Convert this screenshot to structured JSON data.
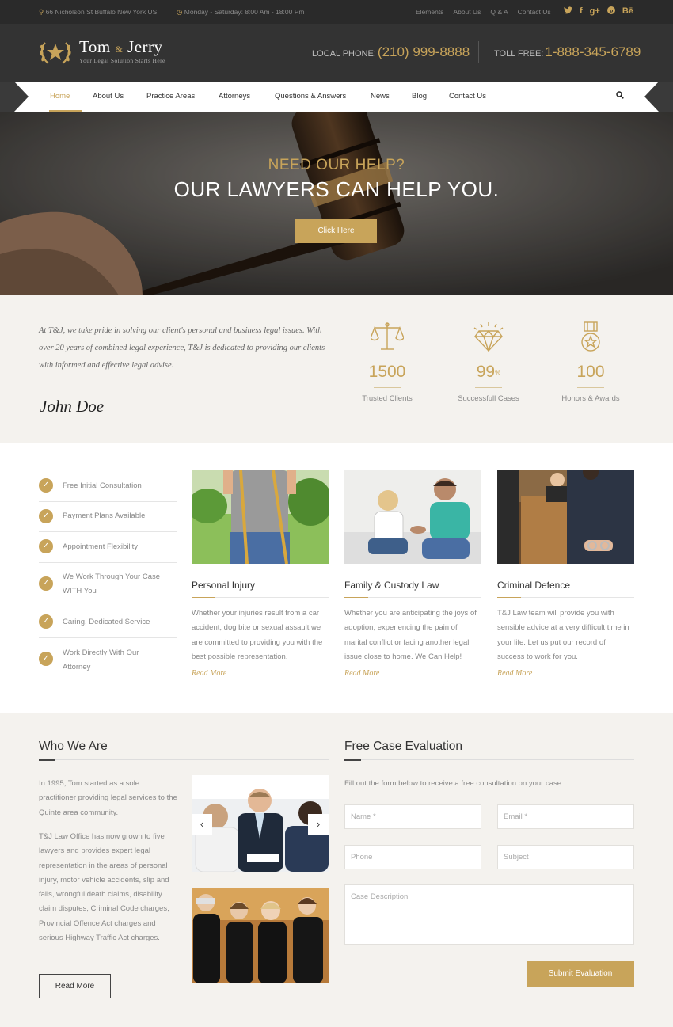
{
  "topbar": {
    "address": "66 Nicholson St Buffalo New York US",
    "hours": "Monday - Saturday: 8:00 Am - 18:00 Pm",
    "links": [
      "Elements",
      "About Us",
      "Q & A",
      "Contact Us"
    ],
    "social": [
      "twitter-icon",
      "facebook-icon",
      "google-plus-icon",
      "pinterest-icon",
      "behance-icon"
    ],
    "behance_label": "Bē"
  },
  "header": {
    "brand_main1": "Tom",
    "brand_amp": "&",
    "brand_main2": "Jerry",
    "tagline": "Your Legal Solution Starts Here",
    "local_label": "LOCAL PHONE:",
    "local_number": "(210) 999-8888",
    "tollfree_label": "TOLL FREE:",
    "tollfree_number": "1-888-345-6789"
  },
  "nav": {
    "items": [
      "Home",
      "About Us",
      "Practice Areas",
      "Attorneys",
      "Questions & Answers",
      "News",
      "Blog",
      "Contact Us"
    ],
    "active": "Home"
  },
  "hero": {
    "kicker": "NEED OUR HELP?",
    "headline": "OUR LAWYERS CAN HELP YOU.",
    "button": "Click Here"
  },
  "intro": {
    "quote": "At T&J, we take pride in solving our client's personal and business legal issues. With over 20 years of combined legal experience, T&J is dedicated to providing our clients with informed and effective legal advise.",
    "signature": "John Doe",
    "stats": [
      {
        "icon": "scales-icon",
        "value": "1500",
        "suffix": "",
        "label": "Trusted Clients"
      },
      {
        "icon": "diamond-icon",
        "value": "99",
        "suffix": "%",
        "label": "Successfull Cases"
      },
      {
        "icon": "medal-icon",
        "value": "100",
        "suffix": "",
        "label": "Honors & Awards"
      }
    ]
  },
  "features": [
    "Free Initial Consultation",
    "Payment Plans Available",
    "Appointment Flexibility",
    "We Work Through Your Case WITH You",
    "Caring, Dedicated Service",
    "Work Directly With Our Attorney"
  ],
  "practice": [
    {
      "title": "Personal Injury",
      "desc": "Whether your injuries result from a car accident, dog bite or sexual assault we are committed to providing you with the best possible representation.",
      "more": "Read More"
    },
    {
      "title": "Family & Custody Law",
      "desc": "Whether you are anticipating the joys of adoption, experiencing the pain of marital conflict or facing another legal issue close to home. We Can Help!",
      "more": "Read More"
    },
    {
      "title": "Criminal Defence",
      "desc": "T&J Law team will provide you with sensible advice at a very difficult time in your life. Let us put our record of success to work for you.",
      "more": "Read More"
    }
  ],
  "who": {
    "title": "Who We Are",
    "p1": "In 1995, Tom started as a sole practitioner providing legal services to the Quinte area community.",
    "p2": "T&J Law Office has now grown to five lawyers and provides expert legal representation in the areas of personal injury, motor vehicle accidents, slip and falls, wrongful death claims, disability claim disputes, Criminal Code charges, Provincial Offence Act charges and serious Highway Traffic Act charges.",
    "button": "Read More"
  },
  "evaluation": {
    "title": "Free Case Evaluation",
    "intro": "Fill out the form below to receive a free consultation on your case.",
    "name_ph": "Name *",
    "email_ph": "Email *",
    "phone_ph": "Phone",
    "subject_ph": "Subject",
    "desc_ph": "Case Description",
    "submit": "Submit Evaluation"
  },
  "colors": {
    "accent": "#c8a45a",
    "dark": "#333333",
    "topbar": "#2a2a2a"
  }
}
